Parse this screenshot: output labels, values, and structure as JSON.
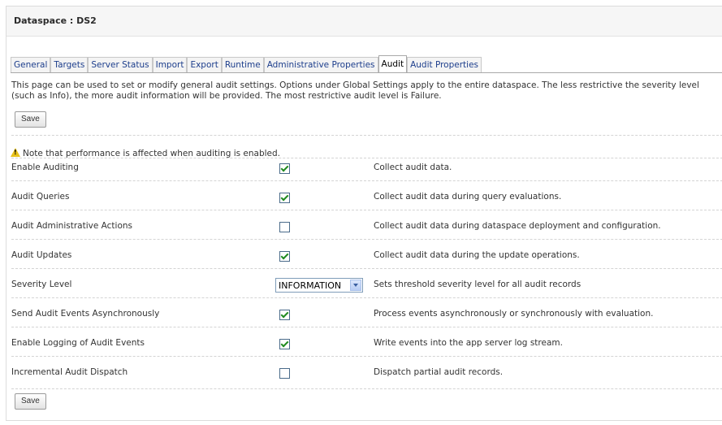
{
  "header": {
    "title": "Dataspace : DS2"
  },
  "tabs": [
    {
      "label": "General"
    },
    {
      "label": "Targets"
    },
    {
      "label": "Server Status"
    },
    {
      "label": "Import"
    },
    {
      "label": "Export"
    },
    {
      "label": "Runtime"
    },
    {
      "label": "Administrative Properties"
    },
    {
      "label": "Audit",
      "active": true
    },
    {
      "label": "Audit Properties"
    }
  ],
  "description": "This page can be used to set or modify general audit settings. Options under Global Settings apply to the entire dataspace. The less restrictive the severity level (such as Info), the more audit information will be provided. The most restrictive audit level is Failure.",
  "buttons": {
    "save_label": "Save"
  },
  "note": "Note that performance is affected when auditing is enabled.",
  "settings": [
    {
      "label": "Enable Auditing",
      "control": "checkbox",
      "checked": true,
      "description": "Collect audit data."
    },
    {
      "label": "Audit Queries",
      "control": "checkbox",
      "checked": true,
      "description": "Collect audit data during query evaluations."
    },
    {
      "label": "Audit Administrative Actions",
      "control": "checkbox",
      "checked": false,
      "description": "Collect audit data during dataspace deployment and configuration."
    },
    {
      "label": "Audit Updates",
      "control": "checkbox",
      "checked": true,
      "description": "Collect audit data during the update operations."
    },
    {
      "label": "Severity Level",
      "control": "select",
      "value": "INFORMATION",
      "description": "Sets threshold severity level for all audit records"
    },
    {
      "label": "Send Audit Events Asynchronously",
      "control": "checkbox",
      "checked": true,
      "description": "Process events asynchronously or synchronously with evaluation."
    },
    {
      "label": "Enable Logging of Audit Events",
      "control": "checkbox",
      "checked": true,
      "description": "Write events into the app server log stream."
    },
    {
      "label": "Incremental Audit Dispatch",
      "control": "checkbox",
      "checked": false,
      "description": "Dispatch partial audit records."
    }
  ]
}
